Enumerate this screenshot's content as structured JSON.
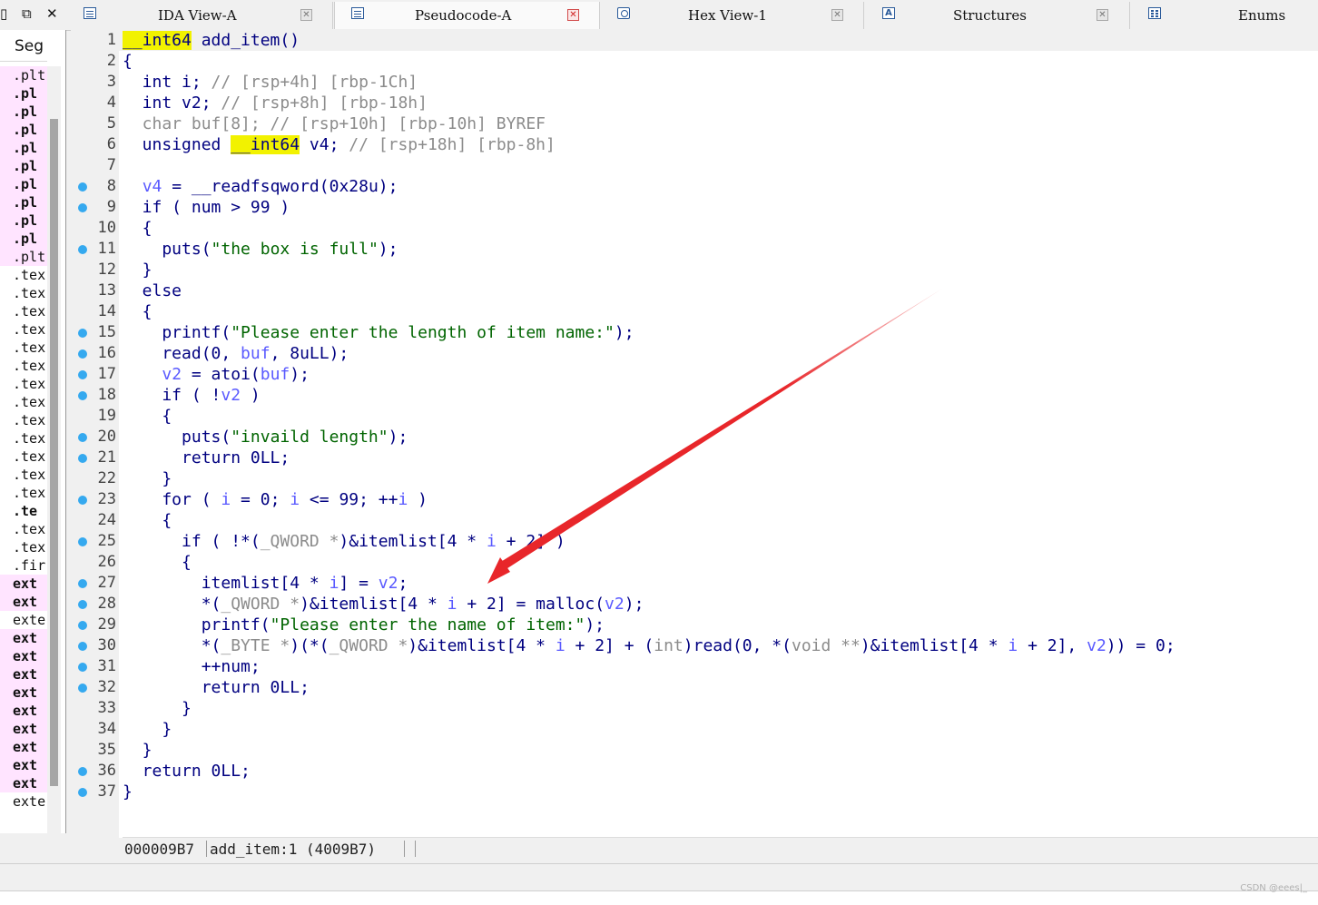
{
  "tabs": [
    {
      "label": "IDA View-A",
      "icon": "ida-view-icon"
    },
    {
      "label": "Pseudocode-A",
      "icon": "pseudocode-icon"
    },
    {
      "label": "Hex View-1",
      "icon": "hex-view-icon"
    },
    {
      "label": "Structures",
      "icon": "structures-icon"
    },
    {
      "label": "Enums",
      "icon": "enums-icon"
    }
  ],
  "segments": {
    "header": "Seg",
    "items": [
      ".plt",
      ".pl",
      ".pl",
      ".pl",
      ".pl",
      ".pl",
      ".pl",
      ".pl",
      ".pl",
      ".pl",
      ".plt",
      ".tex",
      ".tex",
      ".tex",
      ".tex",
      ".tex",
      ".tex",
      ".tex",
      ".tex",
      ".tex",
      ".tex",
      ".tex",
      ".tex",
      ".tex",
      ".te",
      ".tex",
      ".tex",
      ".fir",
      "ext",
      "ext",
      "exte",
      "ext",
      "ext",
      "ext",
      "ext",
      "ext",
      "ext",
      "ext",
      "ext",
      "ext",
      "exte"
    ]
  },
  "code_lines": [
    {
      "num": "1",
      "dot": false
    },
    {
      "num": "2",
      "dot": false
    },
    {
      "num": "3",
      "dot": false
    },
    {
      "num": "4",
      "dot": false
    },
    {
      "num": "5",
      "dot": false
    },
    {
      "num": "6",
      "dot": false
    },
    {
      "num": "7",
      "dot": false
    },
    {
      "num": "8",
      "dot": true
    },
    {
      "num": "9",
      "dot": true
    },
    {
      "num": "10",
      "dot": false
    },
    {
      "num": "11",
      "dot": true
    },
    {
      "num": "12",
      "dot": false
    },
    {
      "num": "13",
      "dot": false
    },
    {
      "num": "14",
      "dot": false
    },
    {
      "num": "15",
      "dot": true
    },
    {
      "num": "16",
      "dot": true
    },
    {
      "num": "17",
      "dot": true
    },
    {
      "num": "18",
      "dot": true
    },
    {
      "num": "19",
      "dot": false
    },
    {
      "num": "20",
      "dot": true
    },
    {
      "num": "21",
      "dot": true
    },
    {
      "num": "22",
      "dot": false
    },
    {
      "num": "23",
      "dot": true
    },
    {
      "num": "24",
      "dot": false
    },
    {
      "num": "25",
      "dot": true
    },
    {
      "num": "26",
      "dot": false
    },
    {
      "num": "27",
      "dot": true
    },
    {
      "num": "28",
      "dot": true
    },
    {
      "num": "29",
      "dot": true
    },
    {
      "num": "30",
      "dot": true
    },
    {
      "num": "31",
      "dot": true
    },
    {
      "num": "32",
      "dot": true
    },
    {
      "num": "33",
      "dot": false
    },
    {
      "num": "34",
      "dot": false
    },
    {
      "num": "35",
      "dot": false
    },
    {
      "num": "36",
      "dot": true
    },
    {
      "num": "37",
      "dot": true
    }
  ],
  "code": {
    "l1_a": "__int64",
    "l1_b": " add_item()",
    "l2": "{",
    "l3_a": "  int i; ",
    "l3_b": "// [rsp+4h] [rbp-1Ch]",
    "l4_a": "  int v2; ",
    "l4_b": "// [rsp+8h] [rbp-18h]",
    "l5": "  char buf[8]; // [rsp+10h] [rbp-10h] BYREF",
    "l6_a": "  unsigned ",
    "l6_b": "__int64",
    "l6_c": " v4; ",
    "l6_d": "// [rsp+18h] [rbp-8h]",
    "l7": "",
    "l8_a": "  ",
    "l8_b": "v4",
    "l8_c": " = __readfsqword(0x28u);",
    "l9": "  if ( num > 99 )",
    "l10": "  {",
    "l11_a": "    puts(",
    "l11_b": "\"the box is full\"",
    "l11_c": ");",
    "l12": "  }",
    "l13": "  else",
    "l14": "  {",
    "l15_a": "    printf(",
    "l15_b": "\"Please enter the length of item name:\"",
    "l15_c": ");",
    "l16_a": "    read(0, ",
    "l16_b": "buf",
    "l16_c": ", 8uLL);",
    "l17_a": "    ",
    "l17_b": "v2",
    "l17_c": " = atoi(",
    "l17_d": "buf",
    "l17_e": ");",
    "l18_a": "    if ( !",
    "l18_b": "v2",
    "l18_c": " )",
    "l19": "    {",
    "l20_a": "      puts(",
    "l20_b": "\"invaild length\"",
    "l20_c": ");",
    "l21": "      return 0LL;",
    "l22": "    }",
    "l23_a": "    for ( ",
    "l23_b": "i",
    "l23_c": " = 0; ",
    "l23_d": "i",
    "l23_e": " <= 99; ++",
    "l23_f": "i",
    "l23_g": " )",
    "l24": "    {",
    "l25_a": "      if ( !*(",
    "l25_b": "_QWORD *",
    "l25_c": ")&itemlist[4 * ",
    "l25_d": "i",
    "l25_e": " + 2] )",
    "l26": "      {",
    "l27_a": "        itemlist[4 * ",
    "l27_b": "i",
    "l27_c": "] = ",
    "l27_d": "v2",
    "l27_e": ";",
    "l28_a": "        *(",
    "l28_b": "_QWORD *",
    "l28_c": ")&itemlist[4 * ",
    "l28_d": "i",
    "l28_e": " + 2] = malloc(",
    "l28_f": "v2",
    "l28_g": ");",
    "l29_a": "        printf(",
    "l29_b": "\"Please enter the name of item:\"",
    "l29_c": ");",
    "l30_a": "        *(",
    "l30_b": "_BYTE *",
    "l30_c": ")(*(",
    "l30_d": "_QWORD *",
    "l30_e": ")&itemlist[4 * ",
    "l30_f": "i",
    "l30_g": " + 2] + (",
    "l30_h": "int",
    "l30_i": ")read(0, *(",
    "l30_j": "void **",
    "l30_k": ")&itemlist[4 * ",
    "l30_l": "i",
    "l30_m": " + 2], ",
    "l30_n": "v2",
    "l30_o": ")) = 0;",
    "l31": "        ++num;",
    "l32": "        return 0LL;",
    "l33": "      }",
    "l34": "    }",
    "l35": "  }",
    "l36": "  return 0LL;",
    "l37": "}"
  },
  "status": {
    "address": "000009B7",
    "location": "add_item:1 (4009B7)"
  },
  "watermark": "CSDN @eees|_",
  "colors": {
    "keyword": "#000080",
    "comment": "#8c8c8c",
    "variable": "#5a5aff",
    "string": "#006400",
    "highlight": "#f2f200",
    "arrow": "#e8262a"
  }
}
